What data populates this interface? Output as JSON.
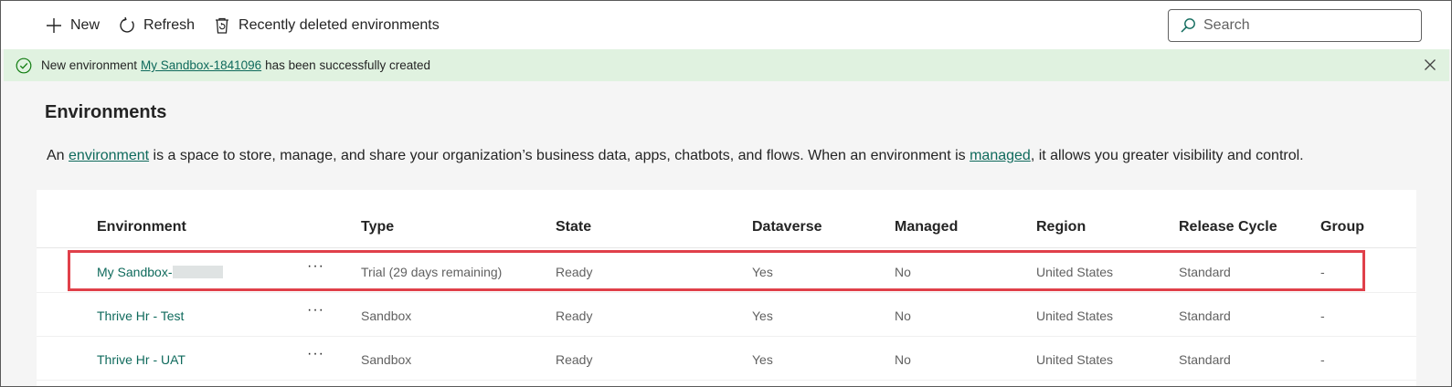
{
  "toolbar": {
    "new_label": "New",
    "refresh_label": "Refresh",
    "recently_deleted_label": "Recently deleted environments",
    "search_placeholder": "Search"
  },
  "banner": {
    "prefix": "New environment",
    "link": "My Sandbox-1841096",
    "suffix": "has been successfully created",
    "status_color": "#e0f2e0"
  },
  "page": {
    "title": "Environments",
    "desc_part1": "An",
    "desc_link1": "environment",
    "desc_part2": "is a space to store, manage, and share your organization’s business data, apps, chatbots, and flows. When an environment is",
    "desc_link2": "managed",
    "desc_part3": ", it allows you greater visibility and control."
  },
  "table": {
    "columns": [
      "Environment",
      "Type",
      "State",
      "Dataverse",
      "Managed",
      "Region",
      "Release Cycle",
      "Group"
    ],
    "rows": [
      {
        "name": "My Sandbox-",
        "type": "Trial (29 days remaining)",
        "state": "Ready",
        "dataverse": "Yes",
        "managed": "No",
        "region": "United States",
        "release": "Standard",
        "group": "-"
      },
      {
        "name": "Thrive Hr - Test",
        "type": "Sandbox",
        "state": "Ready",
        "dataverse": "Yes",
        "managed": "No",
        "region": "United States",
        "release": "Standard",
        "group": "-"
      },
      {
        "name": "Thrive Hr - UAT",
        "type": "Sandbox",
        "state": "Ready",
        "dataverse": "Yes",
        "managed": "No",
        "region": "United States",
        "release": "Standard",
        "group": "-"
      }
    ],
    "more_label": "···"
  },
  "colors": {
    "link": "#0f6a5c",
    "highlight": "#e0404a"
  }
}
